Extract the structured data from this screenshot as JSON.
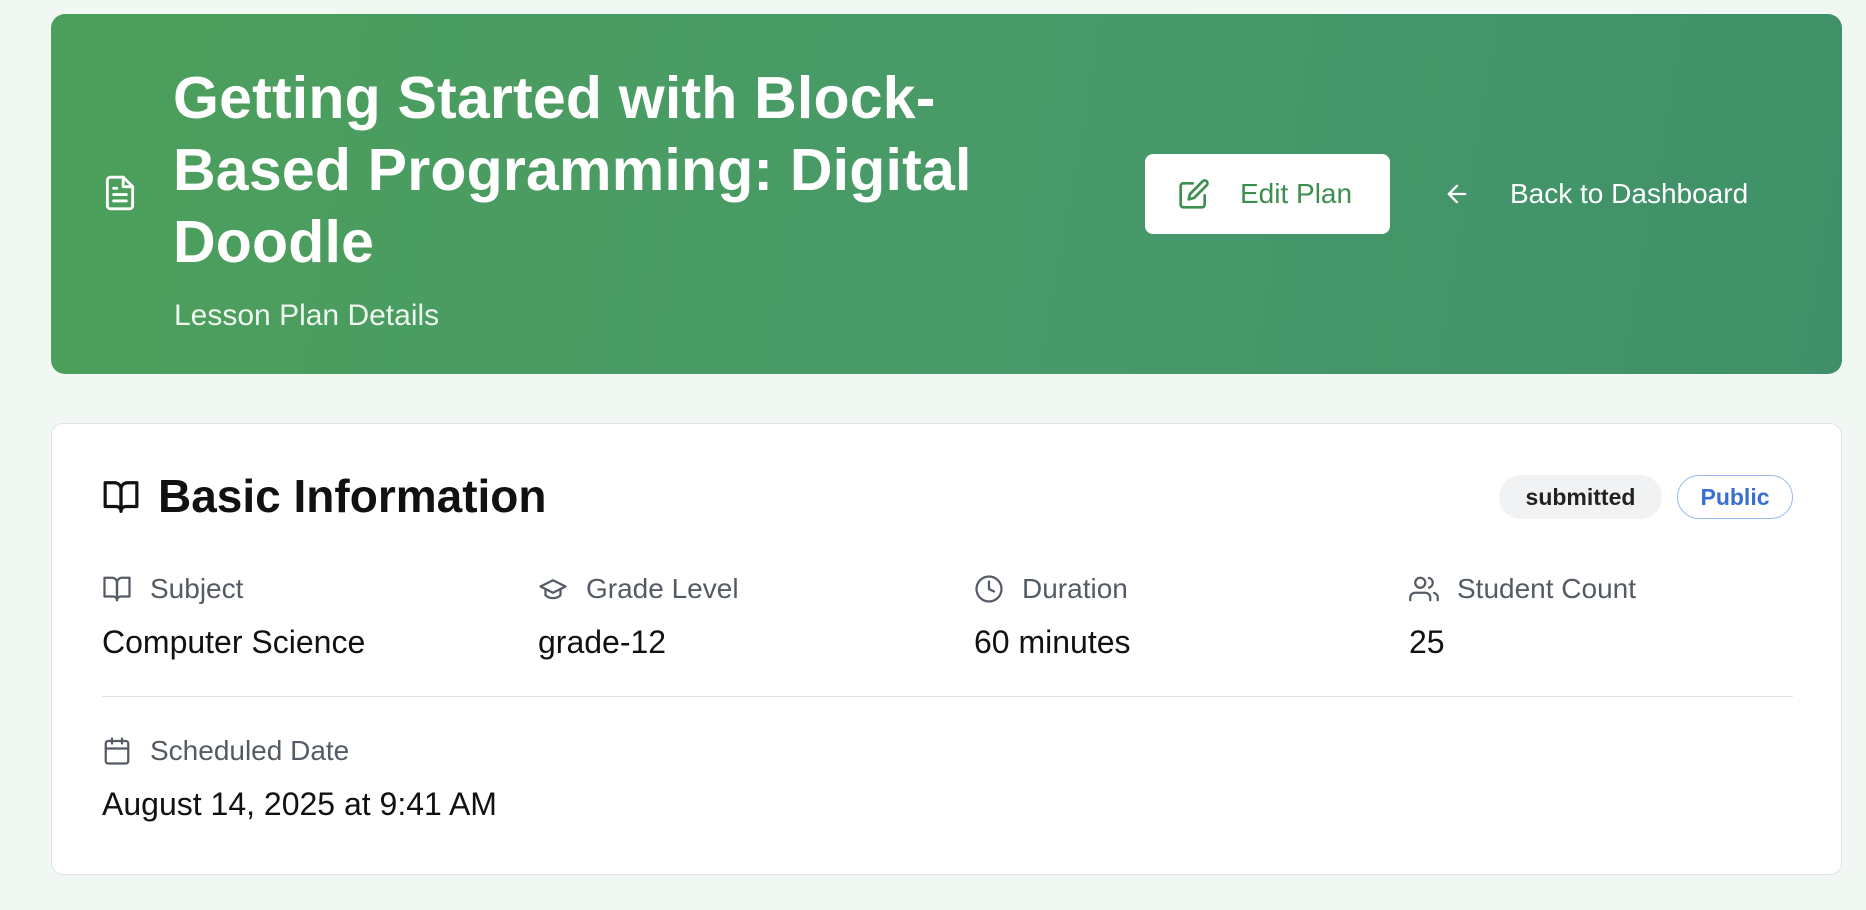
{
  "header": {
    "title": "Getting Started with Block-Based Programming: Digital Doodle",
    "subtitle": "Lesson Plan Details",
    "edit_label": "Edit Plan",
    "back_label": "Back to Dashboard",
    "icons": {
      "document": "document-icon",
      "edit": "edit-icon",
      "back": "arrow-left-icon"
    }
  },
  "basic_info": {
    "title": "Basic Information",
    "status_badge": "submitted",
    "visibility_badge": "Public",
    "fields": [
      {
        "icon": "book-icon",
        "label": "Subject",
        "value": "Computer Science"
      },
      {
        "icon": "graduation-cap-icon",
        "label": "Grade Level",
        "value": "grade-12"
      },
      {
        "icon": "clock-icon",
        "label": "Duration",
        "value": "60 minutes"
      },
      {
        "icon": "users-icon",
        "label": "Student Count",
        "value": "25"
      },
      {
        "icon": "calendar-icon",
        "label": "Scheduled Date",
        "value": "August 14, 2025 at 9:41 AM"
      }
    ]
  },
  "colors": {
    "hero_start": "#4c9f5a",
    "hero_end": "#3f9068",
    "accent_green": "#3e8e50",
    "public_blue": "#3a6fd1"
  }
}
